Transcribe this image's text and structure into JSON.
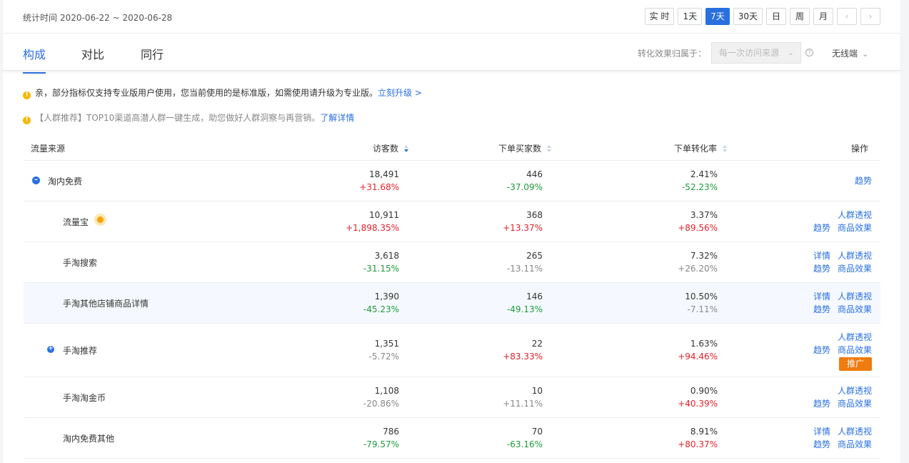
{
  "header": {
    "date_range_label": "统计时间",
    "date_range": "2020-06-22 ~ 2020-06-28",
    "range_buttons": [
      "实 时",
      "1天",
      "7天",
      "30天",
      "日",
      "周",
      "月"
    ],
    "active_range": "7天",
    "prev_icon": "chevron-left-icon",
    "next_icon": "chevron-right-icon"
  },
  "tabs": [
    {
      "label": "构成",
      "active": true
    },
    {
      "label": "对比",
      "active": false
    },
    {
      "label": "同行",
      "active": false
    }
  ],
  "conversion": {
    "label": "转化效果归属于：",
    "select_value": "每一次访问来源",
    "help_icon": "question-circle-icon"
  },
  "device": {
    "value": "无线端"
  },
  "notices": [
    {
      "text": "亲，部分指标仅支持专业版用户使用，您当前使用的是标准版，如需使用请升级为专业版。",
      "link": "立刻升级 >"
    },
    {
      "text": "【人群推荐】TOP10渠道高潜人群一键生成，助您做好人群洞察与再营销。",
      "link": "了解详情"
    }
  ],
  "table": {
    "headers": {
      "source": "流量来源",
      "visitors": "访客数",
      "buyers": "下单买家数",
      "rate": "下单转化率",
      "ops": "操作"
    },
    "rows": [
      {
        "name": "淘内免费",
        "visitors": "18,491",
        "visitors_change": "+31.68%",
        "buyers": "446",
        "buyers_change": "-37.09%",
        "rate": "2.41%",
        "rate_change": "-52.23%",
        "ops": [
          "趋势"
        ]
      },
      {
        "name": "流量宝",
        "visitors": "10,911",
        "visitors_change": "+1,898.35%",
        "buyers": "368",
        "buyers_change": "+13.37%",
        "rate": "3.37%",
        "rate_change": "+89.56%",
        "ops": [
          "人群透视",
          "趋势",
          "商品效果"
        ]
      },
      {
        "name": "手淘搜索",
        "visitors": "3,618",
        "visitors_change": "-31.15%",
        "buyers": "265",
        "buyers_change": "-13.11%",
        "rate": "7.32%",
        "rate_change": "+26.20%",
        "ops": [
          "详情",
          "人群透视",
          "趋势",
          "商品效果"
        ]
      },
      {
        "name": "手淘其他店铺商品详情",
        "visitors": "1,390",
        "visitors_change": "-45.23%",
        "buyers": "146",
        "buyers_change": "-49.13%",
        "rate": "10.50%",
        "rate_change": "-7.11%",
        "ops": [
          "详情",
          "人群透视",
          "趋势",
          "商品效果"
        ]
      },
      {
        "name": "手淘推荐",
        "visitors": "1,351",
        "visitors_change": "-5.72%",
        "buyers": "22",
        "buyers_change": "+83.33%",
        "rate": "1.63%",
        "rate_change": "+94.46%",
        "ops": [
          "人群透视",
          "趋势",
          "商品效果",
          "推广"
        ]
      },
      {
        "name": "手淘淘金币",
        "visitors": "1,108",
        "visitors_change": "-20.86%",
        "buyers": "10",
        "buyers_change": "+11.11%",
        "rate": "0.90%",
        "rate_change": "+40.39%",
        "ops": [
          "人群透视",
          "趋势",
          "商品效果"
        ]
      },
      {
        "name": "淘内免费其他",
        "visitors": "786",
        "visitors_change": "-79.57%",
        "buyers": "70",
        "buyers_change": "-63.16%",
        "rate": "8.91%",
        "rate_change": "+80.37%",
        "ops": [
          "详情",
          "人群透视",
          "趋势",
          "商品效果"
        ]
      }
    ]
  },
  "colors": {
    "accent": "#2a6fe0",
    "increase": "#e5202a",
    "decrease": "#1f9a3a",
    "neutral": "#888888",
    "promo": "#f07b0e",
    "notice": "#f5b800"
  }
}
